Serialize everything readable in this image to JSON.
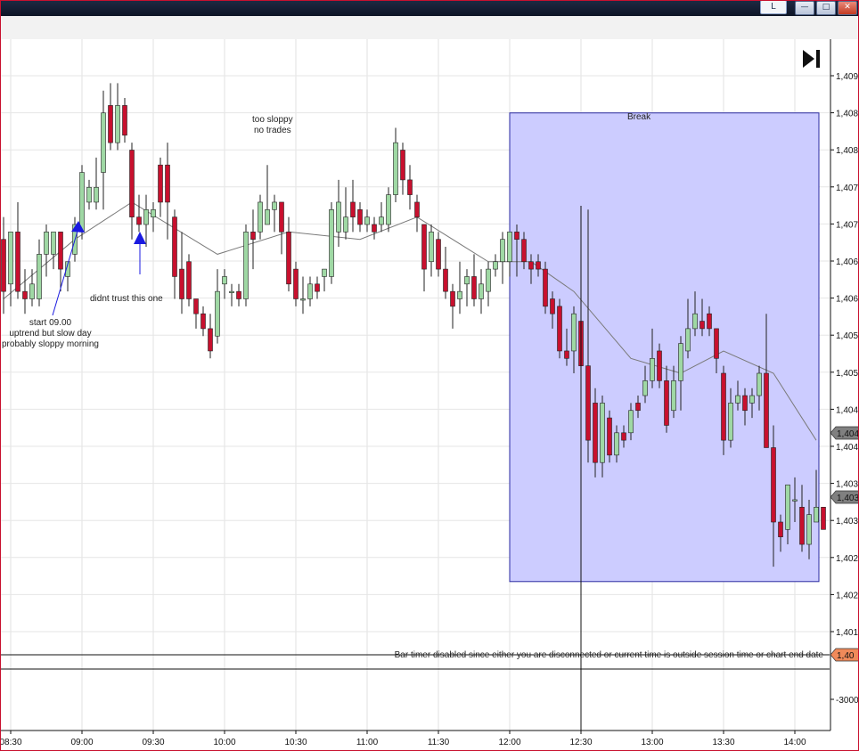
{
  "window": {
    "layout_button_label": "L",
    "min_icon": "minimize-icon",
    "max_icon": "maximize-icon",
    "close_icon": "close-icon",
    "titlebar_color": "#0e1526"
  },
  "toolbar": {
    "goto_end_icon": "skip-to-end-icon"
  },
  "annotations": {
    "start": [
      "start 09.00",
      "uptrend but slow day",
      "probably sloppy morning"
    ],
    "didnt_trust": "didnt trust this one",
    "too_sloppy": [
      "too sloppy",
      "no trades"
    ],
    "break_label": "Break",
    "bar_timer": "Bar timer disabled since either you are disconnected or current time is outside session time or chart end date"
  },
  "colors": {
    "up_candle": "#9fd8a4",
    "down_candle": "#c8102e",
    "moving_average": "#7a7a7a",
    "break_region": "#ccccff",
    "break_border": "#2a2aa0",
    "arrow": "#1a1ae0",
    "price_marker": "#808080",
    "alert_marker": "#f08a5a"
  },
  "chart_data": {
    "type": "candlestick",
    "x_ticks": [
      "08:30",
      "09:00",
      "09:30",
      "10:00",
      "10:30",
      "11:00",
      "11:30",
      "12:00",
      "12:30",
      "13:00",
      "13:30",
      "14:00"
    ],
    "y_ticks": [
      "1,409",
      "1,408",
      "1,408",
      "1,407",
      "1,407",
      "1,406",
      "1,406",
      "1,405",
      "1,405",
      "1,404",
      "1,404",
      "1,403",
      "1,403",
      "1,402",
      "1,402",
      "1,401"
    ],
    "lower_panel_tick": "-3000",
    "price_markers": [
      "1,404",
      "1,403",
      "1,40"
    ],
    "bar_interval_minutes": 3,
    "first_bar_time": "08:27",
    "last_bar_time": "14:09",
    "candles": [
      {
        "o": 1406.8,
        "h": 1407.1,
        "l": 1405.8,
        "c": 1406.1
      },
      {
        "o": 1406.2,
        "h": 1406.9,
        "l": 1405.9,
        "c": 1406.9
      },
      {
        "o": 1406.9,
        "h": 1407.3,
        "l": 1406.0,
        "c": 1406.1
      },
      {
        "o": 1406.1,
        "h": 1406.4,
        "l": 1405.8,
        "c": 1406.0
      },
      {
        "o": 1406.0,
        "h": 1406.4,
        "l": 1405.9,
        "c": 1406.2
      },
      {
        "o": 1406.0,
        "h": 1406.8,
        "l": 1405.9,
        "c": 1406.6
      },
      {
        "o": 1406.6,
        "h": 1407.0,
        "l": 1406.3,
        "c": 1406.9
      },
      {
        "o": 1406.6,
        "h": 1406.9,
        "l": 1406.4,
        "c": 1406.9
      },
      {
        "o": 1406.9,
        "h": 1406.9,
        "l": 1406.1,
        "c": 1406.4
      },
      {
        "o": 1406.3,
        "h": 1406.5,
        "l": 1406.1,
        "c": 1406.5
      },
      {
        "o": 1406.6,
        "h": 1407.1,
        "l": 1406.5,
        "c": 1407.0
      },
      {
        "o": 1406.9,
        "h": 1407.8,
        "l": 1406.8,
        "c": 1407.7
      },
      {
        "o": 1407.3,
        "h": 1407.6,
        "l": 1407.2,
        "c": 1407.5
      },
      {
        "o": 1407.3,
        "h": 1407.9,
        "l": 1407.2,
        "c": 1407.5
      },
      {
        "o": 1407.7,
        "h": 1408.8,
        "l": 1407.2,
        "c": 1408.5
      },
      {
        "o": 1408.6,
        "h": 1408.9,
        "l": 1408.0,
        "c": 1408.1
      },
      {
        "o": 1408.1,
        "h": 1408.9,
        "l": 1408.0,
        "c": 1408.6
      },
      {
        "o": 1408.6,
        "h": 1408.7,
        "l": 1408.1,
        "c": 1408.2
      },
      {
        "o": 1408.0,
        "h": 1408.1,
        "l": 1406.8,
        "c": 1407.1
      },
      {
        "o": 1407.1,
        "h": 1407.4,
        "l": 1406.9,
        "c": 1407.0
      },
      {
        "o": 1407.0,
        "h": 1407.4,
        "l": 1406.7,
        "c": 1407.2
      },
      {
        "o": 1407.1,
        "h": 1407.3,
        "l": 1406.9,
        "c": 1407.2
      },
      {
        "o": 1407.8,
        "h": 1407.9,
        "l": 1407.1,
        "c": 1407.3
      },
      {
        "o": 1407.8,
        "h": 1408.1,
        "l": 1406.8,
        "c": 1407.3
      },
      {
        "o": 1407.1,
        "h": 1407.2,
        "l": 1406.0,
        "c": 1406.3
      },
      {
        "o": 1406.4,
        "h": 1406.9,
        "l": 1405.8,
        "c": 1406.0
      },
      {
        "o": 1406.5,
        "h": 1406.6,
        "l": 1405.9,
        "c": 1406.0
      },
      {
        "o": 1406.0,
        "h": 1406.0,
        "l": 1405.6,
        "c": 1405.8
      },
      {
        "o": 1405.8,
        "h": 1405.9,
        "l": 1405.5,
        "c": 1405.6
      },
      {
        "o": 1405.6,
        "h": 1405.8,
        "l": 1405.2,
        "c": 1405.3
      },
      {
        "o": 1405.5,
        "h": 1406.4,
        "l": 1405.4,
        "c": 1406.1
      },
      {
        "o": 1406.2,
        "h": 1406.4,
        "l": 1406.0,
        "c": 1406.3
      },
      {
        "o": 1406.1,
        "h": 1406.2,
        "l": 1405.9,
        "c": 1406.1
      },
      {
        "o": 1406.1,
        "h": 1406.2,
        "l": 1405.9,
        "c": 1406.0
      },
      {
        "o": 1406.0,
        "h": 1407.0,
        "l": 1405.9,
        "c": 1406.9
      },
      {
        "o": 1406.9,
        "h": 1407.2,
        "l": 1406.4,
        "c": 1406.8
      },
      {
        "o": 1406.9,
        "h": 1407.4,
        "l": 1406.8,
        "c": 1407.3
      },
      {
        "o": 1407.0,
        "h": 1407.8,
        "l": 1407.0,
        "c": 1407.2
      },
      {
        "o": 1407.2,
        "h": 1407.4,
        "l": 1406.9,
        "c": 1407.3
      },
      {
        "o": 1407.3,
        "h": 1407.3,
        "l": 1406.6,
        "c": 1406.9
      },
      {
        "o": 1406.9,
        "h": 1407.1,
        "l": 1406.1,
        "c": 1406.2
      },
      {
        "o": 1406.4,
        "h": 1406.5,
        "l": 1405.9,
        "c": 1406.0
      },
      {
        "o": 1406.0,
        "h": 1406.3,
        "l": 1405.8,
        "c": 1406.0
      },
      {
        "o": 1406.0,
        "h": 1406.3,
        "l": 1405.9,
        "c": 1406.2
      },
      {
        "o": 1406.2,
        "h": 1406.3,
        "l": 1406.0,
        "c": 1406.1
      },
      {
        "o": 1406.3,
        "h": 1406.4,
        "l": 1406.1,
        "c": 1406.4
      },
      {
        "o": 1406.3,
        "h": 1407.3,
        "l": 1406.2,
        "c": 1407.2
      },
      {
        "o": 1406.9,
        "h": 1407.6,
        "l": 1406.7,
        "c": 1407.3
      },
      {
        "o": 1406.9,
        "h": 1407.5,
        "l": 1406.8,
        "c": 1407.1
      },
      {
        "o": 1407.3,
        "h": 1407.6,
        "l": 1406.9,
        "c": 1407.1
      },
      {
        "o": 1407.2,
        "h": 1407.3,
        "l": 1406.9,
        "c": 1407.0
      },
      {
        "o": 1407.0,
        "h": 1407.2,
        "l": 1406.9,
        "c": 1407.1
      },
      {
        "o": 1407.0,
        "h": 1407.1,
        "l": 1406.8,
        "c": 1406.9
      },
      {
        "o": 1407.0,
        "h": 1407.3,
        "l": 1406.9,
        "c": 1407.1
      },
      {
        "o": 1407.0,
        "h": 1407.5,
        "l": 1406.9,
        "c": 1407.4
      },
      {
        "o": 1407.4,
        "h": 1408.3,
        "l": 1407.3,
        "c": 1408.1
      },
      {
        "o": 1408.0,
        "h": 1408.1,
        "l": 1407.4,
        "c": 1407.6
      },
      {
        "o": 1407.6,
        "h": 1407.8,
        "l": 1407.2,
        "c": 1407.4
      },
      {
        "o": 1407.3,
        "h": 1407.4,
        "l": 1406.9,
        "c": 1407.1
      },
      {
        "o": 1407.0,
        "h": 1407.0,
        "l": 1406.1,
        "c": 1406.4
      },
      {
        "o": 1406.5,
        "h": 1407.0,
        "l": 1406.3,
        "c": 1406.9
      },
      {
        "o": 1406.8,
        "h": 1406.9,
        "l": 1406.3,
        "c": 1406.4
      },
      {
        "o": 1406.4,
        "h": 1406.7,
        "l": 1406.0,
        "c": 1406.1
      },
      {
        "o": 1406.1,
        "h": 1406.2,
        "l": 1405.6,
        "c": 1405.9
      },
      {
        "o": 1406.0,
        "h": 1406.5,
        "l": 1405.8,
        "c": 1406.1
      },
      {
        "o": 1406.2,
        "h": 1406.4,
        "l": 1405.9,
        "c": 1406.3
      },
      {
        "o": 1406.3,
        "h": 1406.6,
        "l": 1405.9,
        "c": 1406.0
      },
      {
        "o": 1406.0,
        "h": 1406.4,
        "l": 1405.8,
        "c": 1406.2
      },
      {
        "o": 1406.1,
        "h": 1406.5,
        "l": 1405.9,
        "c": 1406.4
      },
      {
        "o": 1406.4,
        "h": 1406.6,
        "l": 1406.3,
        "c": 1406.5
      },
      {
        "o": 1406.5,
        "h": 1406.9,
        "l": 1406.2,
        "c": 1406.8
      },
      {
        "o": 1406.5,
        "h": 1406.9,
        "l": 1406.3,
        "c": 1406.9
      },
      {
        "o": 1406.9,
        "h": 1407.0,
        "l": 1406.3,
        "c": 1406.8
      },
      {
        "o": 1406.8,
        "h": 1406.9,
        "l": 1406.4,
        "c": 1406.5
      },
      {
        "o": 1406.5,
        "h": 1406.6,
        "l": 1406.2,
        "c": 1406.4
      },
      {
        "o": 1406.5,
        "h": 1406.6,
        "l": 1406.3,
        "c": 1406.4
      },
      {
        "o": 1406.4,
        "h": 1406.5,
        "l": 1405.8,
        "c": 1405.9
      },
      {
        "o": 1406.0,
        "h": 1406.1,
        "l": 1405.6,
        "c": 1405.8
      },
      {
        "o": 1405.9,
        "h": 1406.0,
        "l": 1405.2,
        "c": 1405.3
      },
      {
        "o": 1405.3,
        "h": 1405.6,
        "l": 1405.1,
        "c": 1405.2
      },
      {
        "o": 1405.3,
        "h": 1405.9,
        "l": 1405.0,
        "c": 1405.8
      },
      {
        "o": 1405.7,
        "h": 1405.8,
        "l": 1404.9,
        "c": 1405.1
      },
      {
        "o": 1405.1,
        "h": 1407.2,
        "l": 1403.8,
        "c": 1404.1
      },
      {
        "o": 1404.6,
        "h": 1404.8,
        "l": 1403.6,
        "c": 1403.8
      },
      {
        "o": 1403.8,
        "h": 1404.7,
        "l": 1403.6,
        "c": 1404.6
      },
      {
        "o": 1404.4,
        "h": 1404.5,
        "l": 1403.8,
        "c": 1403.9
      },
      {
        "o": 1403.9,
        "h": 1404.3,
        "l": 1403.8,
        "c": 1404.2
      },
      {
        "o": 1404.2,
        "h": 1404.3,
        "l": 1404.0,
        "c": 1404.1
      },
      {
        "o": 1404.2,
        "h": 1404.6,
        "l": 1404.1,
        "c": 1404.5
      },
      {
        "o": 1404.6,
        "h": 1404.7,
        "l": 1404.4,
        "c": 1404.5
      },
      {
        "o": 1404.7,
        "h": 1405.1,
        "l": 1404.6,
        "c": 1404.9
      },
      {
        "o": 1404.9,
        "h": 1405.6,
        "l": 1404.8,
        "c": 1405.2
      },
      {
        "o": 1405.3,
        "h": 1405.4,
        "l": 1404.8,
        "c": 1404.9
      },
      {
        "o": 1404.9,
        "h": 1405.1,
        "l": 1404.2,
        "c": 1404.3
      },
      {
        "o": 1404.5,
        "h": 1405.1,
        "l": 1404.4,
        "c": 1404.9
      },
      {
        "o": 1404.9,
        "h": 1405.5,
        "l": 1404.5,
        "c": 1405.4
      },
      {
        "o": 1405.3,
        "h": 1406.0,
        "l": 1405.2,
        "c": 1405.6
      },
      {
        "o": 1405.6,
        "h": 1406.1,
        "l": 1405.5,
        "c": 1405.8
      },
      {
        "o": 1405.7,
        "h": 1406.0,
        "l": 1405.5,
        "c": 1405.6
      },
      {
        "o": 1405.8,
        "h": 1405.9,
        "l": 1405.5,
        "c": 1405.6
      },
      {
        "o": 1405.6,
        "h": 1405.6,
        "l": 1405.0,
        "c": 1405.2
      },
      {
        "o": 1405.0,
        "h": 1405.1,
        "l": 1403.9,
        "c": 1404.1
      },
      {
        "o": 1404.1,
        "h": 1404.8,
        "l": 1404.0,
        "c": 1404.6
      },
      {
        "o": 1404.6,
        "h": 1404.9,
        "l": 1404.5,
        "c": 1404.7
      },
      {
        "o": 1404.7,
        "h": 1404.8,
        "l": 1404.3,
        "c": 1404.5
      },
      {
        "o": 1404.6,
        "h": 1404.8,
        "l": 1404.4,
        "c": 1404.7
      },
      {
        "o": 1404.7,
        "h": 1405.1,
        "l": 1404.5,
        "c": 1405.0
      },
      {
        "o": 1405.0,
        "h": 1405.8,
        "l": 1404.1,
        "c": 1404.0
      },
      {
        "o": 1404.0,
        "h": 1404.3,
        "l": 1402.4,
        "c": 1403.0
      },
      {
        "o": 1403.0,
        "h": 1403.1,
        "l": 1402.6,
        "c": 1402.8
      },
      {
        "o": 1402.9,
        "h": 1403.5,
        "l": 1402.7,
        "c": 1403.5
      },
      {
        "o": 1403.3,
        "h": 1403.6,
        "l": 1403.0,
        "c": 1403.3
      },
      {
        "o": 1403.2,
        "h": 1403.5,
        "l": 1402.6,
        "c": 1402.7
      },
      {
        "o": 1402.7,
        "h": 1403.3,
        "l": 1402.5,
        "c": 1403.1
      },
      {
        "o": 1403.0,
        "h": 1403.7,
        "l": 1403.0,
        "c": 1403.2
      },
      {
        "o": 1403.2,
        "h": 1403.2,
        "l": 1402.9,
        "c": 1402.9
      }
    ],
    "moving_average_anchor_values": [
      {
        "bar": 0,
        "value": 1406.0
      },
      {
        "bar": 10,
        "value": 1406.8
      },
      {
        "bar": 18,
        "value": 1407.3
      },
      {
        "bar": 30,
        "value": 1406.6
      },
      {
        "bar": 40,
        "value": 1406.9
      },
      {
        "bar": 50,
        "value": 1406.8
      },
      {
        "bar": 58,
        "value": 1407.1
      },
      {
        "bar": 68,
        "value": 1406.5
      },
      {
        "bar": 74,
        "value": 1406.5
      },
      {
        "bar": 80,
        "value": 1406.1
      },
      {
        "bar": 88,
        "value": 1405.2
      },
      {
        "bar": 95,
        "value": 1405.0
      },
      {
        "bar": 101,
        "value": 1405.3
      },
      {
        "bar": 108,
        "value": 1405.0
      },
      {
        "bar": 114,
        "value": 1404.1
      }
    ],
    "break_region": {
      "from_time": "12:00",
      "to_time": "14:09",
      "from_price": 1408.5,
      "to_price": 1402.2
    },
    "vertical_line_time": "12:30"
  }
}
